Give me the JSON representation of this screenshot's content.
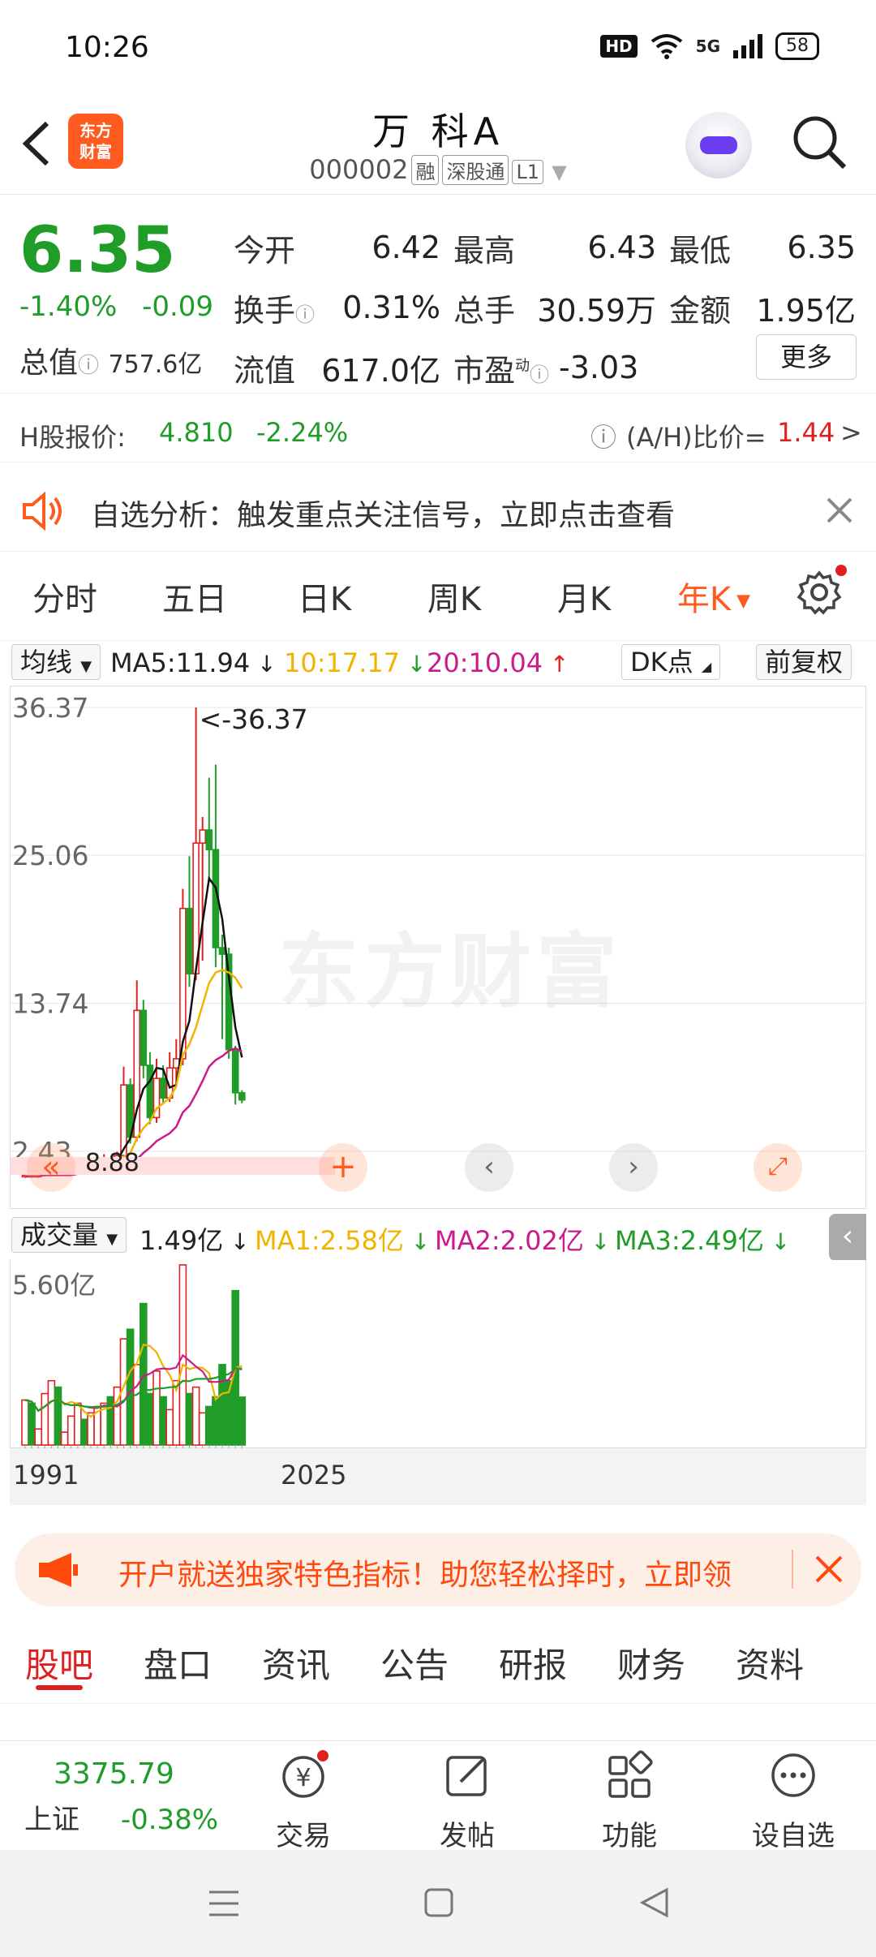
{
  "status": {
    "time": "10:26",
    "hd": "HD",
    "net": "5G",
    "battery": "58"
  },
  "header": {
    "logo_text": "东方\n财富",
    "stock_name": "万 科A",
    "stock_code": "000002",
    "tags": [
      "融",
      "深股通",
      "L1"
    ]
  },
  "quote": {
    "price": "6.35",
    "change_pct": "-1.40%",
    "change_abs": "-0.09",
    "total_value_label": "总值",
    "total_value": "757.6亿",
    "rows": [
      [
        {
          "label": "今开",
          "value": "6.42",
          "color": "green"
        },
        {
          "label": "最高",
          "value": "6.43",
          "color": "green"
        },
        {
          "label": "最低",
          "value": "6.35",
          "color": "green"
        }
      ],
      [
        {
          "label": "换手",
          "value": "0.31%",
          "color": "plain"
        },
        {
          "label": "总手",
          "value": "30.59万",
          "color": "plain"
        },
        {
          "label": "金额",
          "value": "1.95亿",
          "color": "plain"
        }
      ],
      [
        {
          "label": "流值",
          "value": "617.0亿",
          "color": "plain"
        },
        {
          "label": "市盈",
          "value": "-3.03",
          "color": "plain"
        }
      ]
    ],
    "pe_sup": "动",
    "more_label": "更多"
  },
  "hshare": {
    "label": "H股报价:",
    "price": "4.810",
    "change": "-2.24%",
    "ah_label": "(A/H)比价=",
    "ah_value": "1.44",
    "arrow": ">"
  },
  "notice": {
    "text": "自选分析：触发重点关注信号，立即点击查看"
  },
  "period_tabs": [
    {
      "label": "分时",
      "active": false
    },
    {
      "label": "五日",
      "active": false
    },
    {
      "label": "日K",
      "active": false
    },
    {
      "label": "周K",
      "active": false
    },
    {
      "label": "月K",
      "active": false
    },
    {
      "label": "年K",
      "active": true
    }
  ],
  "indicators": {
    "ma_select": "均线",
    "ma5": "MA5:11.94",
    "ma10": "10:17.17",
    "ma20": "20:10.04",
    "dk_label": "DK点",
    "fq_label": "前复权"
  },
  "kline": {
    "y_ticks": [
      "36.37",
      "25.06",
      "13.74",
      "2.43"
    ],
    "max_label": "<-36.37",
    "min_label": "8.88",
    "watermark": "东方财富"
  },
  "volume": {
    "select": "成交量",
    "current": "1.49亿",
    "ma1": "MA1:2.58亿",
    "ma2": "MA2:2.02亿",
    "ma3": "MA3:2.49亿",
    "y_tick": "5.60亿",
    "x_start": "1991",
    "x_end": "2025"
  },
  "chart_data": {
    "type": "candlestick",
    "title": "",
    "xlabel": "",
    "ylabel": "",
    "ylim": [
      0,
      36.37
    ],
    "x": [
      "1991",
      "2025"
    ],
    "candles": [
      {
        "o": 0.5,
        "c": 0.6,
        "h": 0.8,
        "l": 0.4
      },
      {
        "o": 0.6,
        "c": 0.5,
        "h": 0.7,
        "l": 0.4
      },
      {
        "o": 0.5,
        "c": 0.6,
        "h": 0.8,
        "l": 0.4
      },
      {
        "o": 0.6,
        "c": 0.7,
        "h": 0.9,
        "l": 0.5
      },
      {
        "o": 0.7,
        "c": 0.9,
        "h": 1.1,
        "l": 0.6
      },
      {
        "o": 0.9,
        "c": 0.8,
        "h": 1.0,
        "l": 0.7
      },
      {
        "o": 0.8,
        "c": 1.0,
        "h": 1.2,
        "l": 0.7
      },
      {
        "o": 1.0,
        "c": 1.1,
        "h": 1.3,
        "l": 0.9
      },
      {
        "o": 1.1,
        "c": 1.3,
        "h": 1.6,
        "l": 1.0
      },
      {
        "o": 1.3,
        "c": 1.2,
        "h": 1.5,
        "l": 1.0
      },
      {
        "o": 1.2,
        "c": 1.4,
        "h": 1.8,
        "l": 1.1
      },
      {
        "o": 1.4,
        "c": 1.6,
        "h": 1.9,
        "l": 1.3
      },
      {
        "o": 1.6,
        "c": 1.8,
        "h": 2.2,
        "l": 1.5
      },
      {
        "o": 1.8,
        "c": 1.7,
        "h": 2.0,
        "l": 1.5
      },
      {
        "o": 1.7,
        "c": 2.1,
        "h": 2.4,
        "l": 1.6
      },
      {
        "o": 2.1,
        "c": 7.5,
        "h": 8.9,
        "l": 2.0
      },
      {
        "o": 7.5,
        "c": 3.5,
        "h": 8.0,
        "l": 3.0
      },
      {
        "o": 3.5,
        "c": 13.2,
        "h": 15.5,
        "l": 3.2
      },
      {
        "o": 13.2,
        "c": 9.0,
        "h": 14.0,
        "l": 8.0
      },
      {
        "o": 9.0,
        "c": 5.0,
        "h": 10.0,
        "l": 4.5
      },
      {
        "o": 5.0,
        "c": 8.0,
        "h": 9.5,
        "l": 4.6
      },
      {
        "o": 8.0,
        "c": 6.5,
        "h": 9.0,
        "l": 6.0
      },
      {
        "o": 6.5,
        "c": 8.8,
        "h": 10.0,
        "l": 6.2
      },
      {
        "o": 8.8,
        "c": 9.5,
        "h": 11.0,
        "l": 7.5
      },
      {
        "o": 9.5,
        "c": 21.0,
        "h": 22.5,
        "l": 9.0
      },
      {
        "o": 21.0,
        "c": 16.0,
        "h": 25.0,
        "l": 15.0
      },
      {
        "o": 16.0,
        "c": 26.0,
        "h": 36.37,
        "l": 15.5
      },
      {
        "o": 26.0,
        "c": 27.0,
        "h": 28.0,
        "l": 17.0
      },
      {
        "o": 27.0,
        "c": 25.5,
        "h": 31.0,
        "l": 23.0
      },
      {
        "o": 25.5,
        "c": 18.0,
        "h": 32.0,
        "l": 16.5
      },
      {
        "o": 18.0,
        "c": 17.5,
        "h": 19.0,
        "l": 11.0
      },
      {
        "o": 17.5,
        "c": 10.2,
        "h": 18.0,
        "l": 9.5
      },
      {
        "o": 10.2,
        "c": 6.9,
        "h": 10.5,
        "l": 6.0
      },
      {
        "o": 6.9,
        "c": 6.35,
        "h": 7.1,
        "l": 6.1
      }
    ],
    "ma_series": [
      {
        "name": "MA5",
        "color": "#111111",
        "values": [
          0.6,
          0.6,
          0.6,
          0.6,
          0.7,
          0.7,
          0.8,
          0.9,
          1.0,
          1.1,
          1.2,
          1.3,
          1.5,
          1.6,
          1.7,
          2.6,
          3.4,
          5.6,
          7.2,
          7.8,
          8.8,
          8.7,
          7.3,
          7.5,
          10.8,
          12.4,
          16.3,
          19.9,
          23.3,
          22.6,
          20.2,
          15.8,
          11.9,
          9.6
        ]
      },
      {
        "name": "MA10",
        "color": "#f0b400",
        "values": [
          0.6,
          0.6,
          0.6,
          0.6,
          0.6,
          0.6,
          0.7,
          0.7,
          0.8,
          0.9,
          0.9,
          1.0,
          1.1,
          1.2,
          1.4,
          2.0,
          2.3,
          3.4,
          4.2,
          4.7,
          5.7,
          6.1,
          6.5,
          7.4,
          9.8,
          10.6,
          11.9,
          13.6,
          15.3,
          16.1,
          16.3,
          16.1,
          15.7,
          14.9
        ]
      },
      {
        "name": "MA20",
        "color": "#cc1a88",
        "values": [
          0.5,
          0.5,
          0.5,
          0.6,
          0.6,
          0.6,
          0.6,
          0.6,
          0.7,
          0.7,
          0.7,
          0.8,
          0.8,
          0.9,
          0.9,
          1.2,
          1.4,
          1.8,
          2.3,
          2.7,
          3.2,
          3.5,
          3.8,
          4.3,
          5.4,
          5.9,
          6.8,
          7.8,
          8.9,
          9.4,
          9.7,
          10.1,
          10.3,
          10.04
        ]
      }
    ],
    "volume": {
      "ylim": [
        0,
        5.6
      ],
      "values": [
        1.4,
        1.3,
        0.5,
        1.6,
        2.0,
        1.8,
        0.4,
        0.9,
        1.3,
        0.8,
        1.0,
        1.2,
        1.3,
        1.5,
        1.8,
        3.3,
        3.6,
        2.5,
        4.4,
        1.6,
        2.3,
        1.5,
        1.1,
        2.0,
        5.6,
        1.6,
        1.8,
        1.0,
        1.2,
        1.5,
        2.5,
        2.0,
        4.8,
        1.49
      ],
      "up": [
        true,
        false,
        true,
        true,
        true,
        false,
        true,
        true,
        true,
        false,
        true,
        true,
        true,
        false,
        true,
        true,
        false,
        true,
        false,
        false,
        true,
        false,
        true,
        true,
        true,
        false,
        true,
        true,
        false,
        false,
        false,
        false,
        false,
        false
      ]
    }
  },
  "promo": {
    "text": "开户就送独家特色指标！助您轻松择时，立即领"
  },
  "content_tabs": [
    {
      "label": "股吧",
      "active": true
    },
    {
      "label": "盘口",
      "active": false
    },
    {
      "label": "资讯",
      "active": false
    },
    {
      "label": "公告",
      "active": false
    },
    {
      "label": "研报",
      "active": false
    },
    {
      "label": "财务",
      "active": false
    },
    {
      "label": "资料",
      "active": false
    }
  ],
  "toolbar": {
    "index_value": "3375.79",
    "index_name": "上证",
    "index_change": "-0.38%",
    "trade_label": "交易",
    "post_label": "发帖",
    "func_label": "功能",
    "watch_label": "设自选"
  },
  "colors": {
    "up": "#e02020",
    "down": "#1f9d28",
    "accent": "#ff5a1f"
  }
}
